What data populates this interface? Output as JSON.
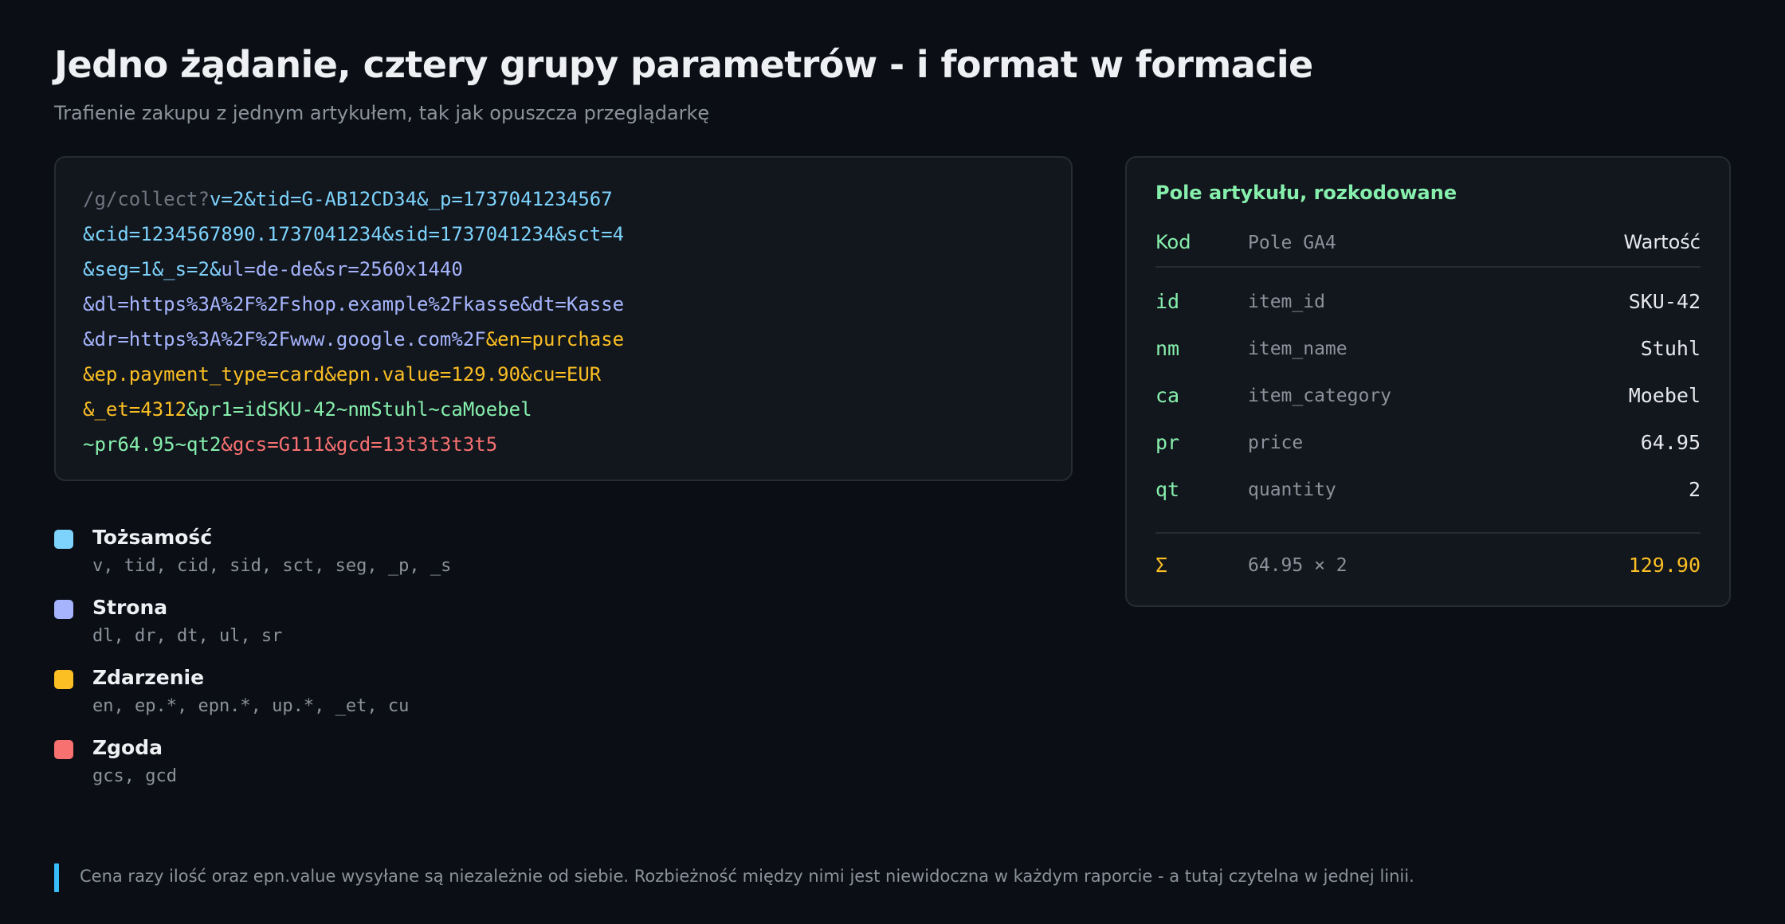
{
  "header": {
    "title": "Jedno żądanie, cztery grupy parametrów - i format w formacie",
    "subtitle": "Trafienie zakupu z jednym artykułem, tak jak opuszcza przeglądarkę"
  },
  "url": {
    "lines": [
      [
        {
          "text": "/g/collect?",
          "group": "path"
        },
        {
          "text": "v=2&tid=G-AB12CD34&_p=1737041234567",
          "group": "id"
        }
      ],
      [
        {
          "text": "&cid=1234567890.1737041234&sid=1737041234&sct=4",
          "group": "id"
        }
      ],
      [
        {
          "text": "&seg=1&_s=2&",
          "group": "id"
        },
        {
          "text": "ul=de-de&sr=2560x1440",
          "group": "page"
        }
      ],
      [
        {
          "text": "&dl=https%3A%2F%2Fshop.example%2Fkasse&dt=Kasse",
          "group": "page"
        }
      ],
      [
        {
          "text": "&dr=https%3A%2F%2Fwww.google.com%2F",
          "group": "page"
        },
        {
          "text": "&en=purchase",
          "group": "event"
        }
      ],
      [
        {
          "text": "&ep.payment_type=card&epn.value=129.90&cu=EUR",
          "group": "event"
        }
      ],
      [
        {
          "text": "&_et=4312",
          "group": "event"
        },
        {
          "text": "&pr1=idSKU-42~nmStuhl~caMoebel",
          "group": "item"
        }
      ],
      [
        {
          "text": "~pr64.95~qt2",
          "group": "item"
        },
        {
          "text": "&gcs=G111&gcd=13t3t3t3t5",
          "group": "consent"
        }
      ]
    ]
  },
  "legend": [
    {
      "name": "Tożsamość",
      "params": "v, tid, cid, sid, sct, seg, _p, _s",
      "color": "#7dd3fc"
    },
    {
      "name": "Strona",
      "params": "dl, dr, dt, ul, sr",
      "color": "#a5b4fc"
    },
    {
      "name": "Zdarzenie",
      "params": "en, ep.*, epn.*, up.*, _et, cu",
      "color": "#fbbf24"
    },
    {
      "name": "Zgoda",
      "params": "gcs, gcd",
      "color": "#f87171"
    }
  ],
  "panel": {
    "title": "Pole artykułu, rozkodowane",
    "headers": {
      "code": "Kod",
      "field": "Pole GA4",
      "value": "Wartość"
    },
    "rows": [
      {
        "code": "id",
        "field": "item_id",
        "value": "SKU-42"
      },
      {
        "code": "nm",
        "field": "item_name",
        "value": "Stuhl"
      },
      {
        "code": "ca",
        "field": "item_category",
        "value": "Moebel"
      },
      {
        "code": "pr",
        "field": "price",
        "value": "64.95"
      },
      {
        "code": "qt",
        "field": "quantity",
        "value": "2"
      }
    ],
    "sum": {
      "symbol": "Σ",
      "formula": "64.95 × 2",
      "value": "129.90"
    }
  },
  "note": "Cena razy ilość oraz epn.value wysyłane są niezależnie od siebie. Rozbieżność między nimi jest niewidoczna w każdym raporcie - a tutaj czytelna w jednej linii.",
  "colors": {
    "identity": "#7dd3fc",
    "page": "#a5b4fc",
    "event": "#fbbf24",
    "item": "#86efac",
    "consent": "#f87171",
    "accent_bar": "#38bdf8"
  }
}
